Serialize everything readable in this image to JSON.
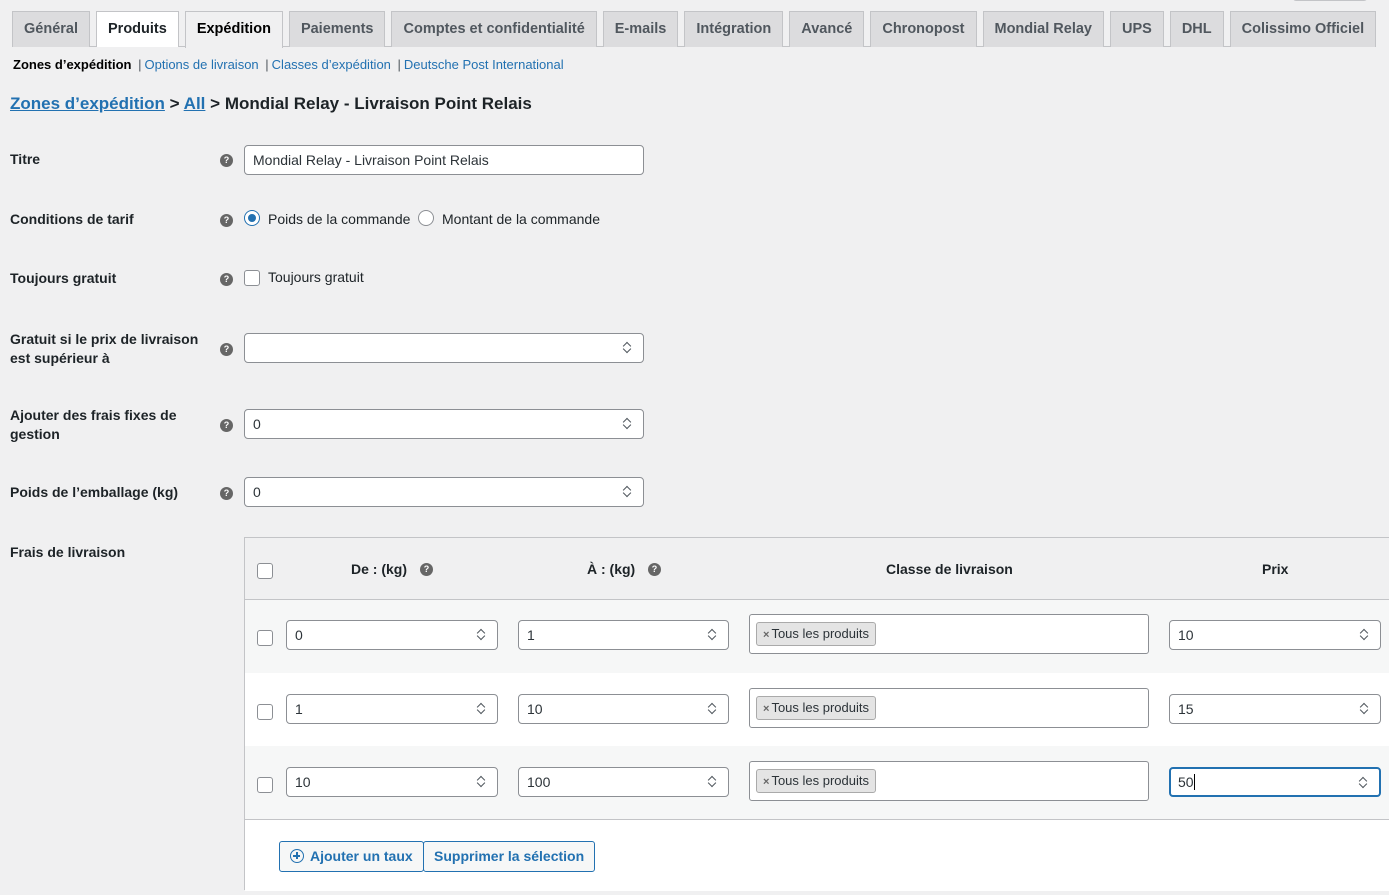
{
  "tabs": [
    {
      "label": "Général"
    },
    {
      "label": "Produits"
    },
    {
      "label": "Expédition"
    },
    {
      "label": "Paiements"
    },
    {
      "label": "Comptes et confidentialité"
    },
    {
      "label": "E-mails"
    },
    {
      "label": "Intégration"
    },
    {
      "label": "Avancé"
    },
    {
      "label": "Chronopost"
    },
    {
      "label": "Mondial Relay"
    },
    {
      "label": "UPS"
    },
    {
      "label": "DHL"
    },
    {
      "label": "Colissimo Officiel"
    }
  ],
  "subnav": {
    "current": "Zones d’expédition",
    "links": [
      "Options de livraison",
      "Classes d’expédition",
      "Deutsche Post International"
    ],
    "separator": "|"
  },
  "breadcrumb": {
    "zones": "Zones d’expédition",
    "sep1": ">",
    "all": "All",
    "sep2": ">",
    "current": "Mondial Relay - Livraison Point Relais"
  },
  "help_glyph": "?",
  "form": {
    "title": {
      "label": "Titre",
      "value": "Mondial Relay - Livraison Point Relais"
    },
    "conditions": {
      "label": "Conditions de tarif",
      "option1": "Poids de la commande",
      "option2": "Montant de la commande",
      "selected": "Poids de la commande"
    },
    "always_free": {
      "label": "Toujours gratuit",
      "checkbox_label": "Toujours gratuit"
    },
    "free_if_above": {
      "label": "Gratuit si le prix de livraison est supérieur à",
      "value": ""
    },
    "handling_fee": {
      "label": "Ajouter des frais fixes de gestion",
      "value": "0"
    },
    "packaging_weight": {
      "label": "Poids de l’emballage (kg)",
      "value": "0"
    },
    "rates_label": "Frais de livraison"
  },
  "rates": {
    "headers": {
      "from": "De : (kg)",
      "to": "À : (kg)",
      "class": "Classe de livraison",
      "price": "Prix"
    },
    "rows": [
      {
        "from": "0",
        "to": "1",
        "class_tag": "Tous les produits",
        "price": "10"
      },
      {
        "from": "1",
        "to": "10",
        "class_tag": "Tous les produits",
        "price": "15"
      },
      {
        "from": "10",
        "to": "100",
        "class_tag": "Tous les produits",
        "price": "50"
      }
    ],
    "tag_remove": "×",
    "add_rate": "Ajouter un taux",
    "delete_selection": "Supprimer la sélection"
  },
  "colors": {
    "accent": "#2271b1",
    "background": "#f0f0f1"
  }
}
